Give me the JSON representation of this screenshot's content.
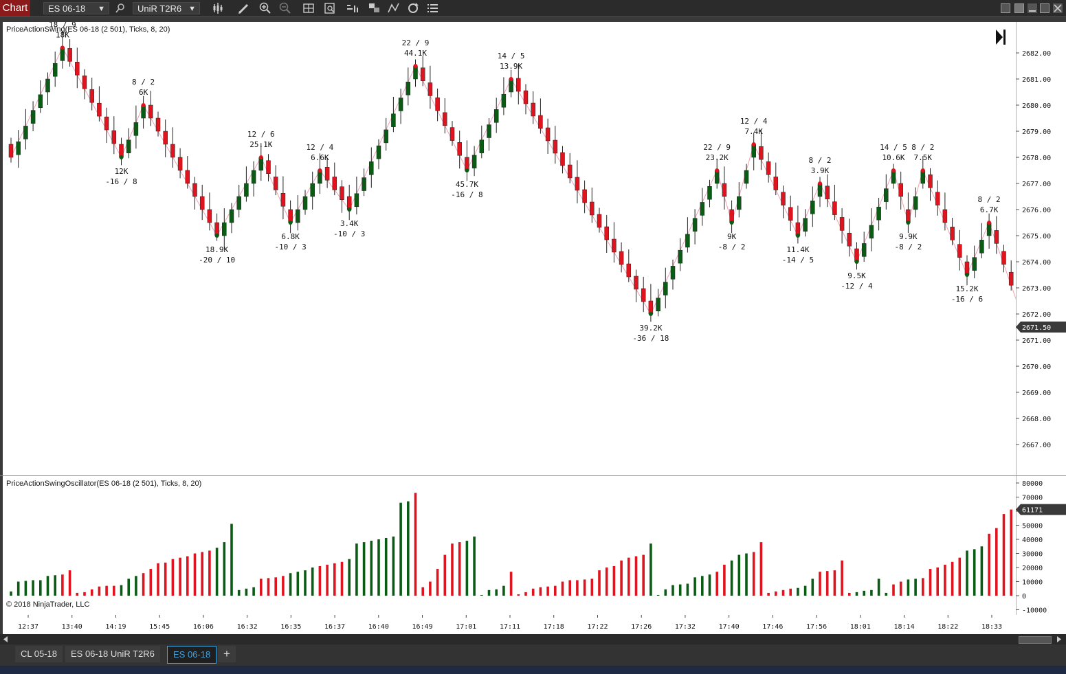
{
  "toolbar": {
    "chart_label": "Chart",
    "instrument": "ES 06-18",
    "bar_type": "UniR T2R6"
  },
  "colors": {
    "up": "#0a5c14",
    "down": "#e0141e",
    "bg": "#ffffff",
    "accent_tab": "#3fa3e0"
  },
  "price_panel": {
    "title": "PriceActionSwing(ES 06-18 (2 501), Ticks, 8, 20)",
    "current_price": "2671.50",
    "y_ticks": [
      "2682.00",
      "2681.00",
      "2680.00",
      "2679.00",
      "2678.00",
      "2677.00",
      "2676.00",
      "2675.00",
      "2674.00",
      "2673.00",
      "2672.00",
      "2671.00",
      "2670.00",
      "2669.00",
      "2668.00",
      "2667.00"
    ],
    "swing_labels": [
      {
        "l1": "18 / 9",
        "l2": "18K"
      },
      {
        "l1": "12K",
        "l2": "-16 / 8"
      },
      {
        "l1": "8 / 2",
        "l2": "6K"
      },
      {
        "l1": "18.9K",
        "l2": "-20 / 10"
      },
      {
        "l1": "12 / 6",
        "l2": "25.1K"
      },
      {
        "l1": "6.8K",
        "l2": "-10 / 3"
      },
      {
        "l1": "12 / 4",
        "l2": "6.6K"
      },
      {
        "l1": "3.4K",
        "l2": "-10 / 3"
      },
      {
        "l1": "22 / 9",
        "l2": "44.1K"
      },
      {
        "l1": "45.7K",
        "l2": "-16 / 8"
      },
      {
        "l1": "14 / 5",
        "l2": "13.9K"
      },
      {
        "l1": "39.2K",
        "l2": "-36 / 18"
      },
      {
        "l1": "22 / 9",
        "l2": "23.2K"
      },
      {
        "l1": "9K",
        "l2": "-8 / 2"
      },
      {
        "l1": "12 / 4",
        "l2": "7.4K"
      },
      {
        "l1": "11.4K",
        "l2": "-14 / 5"
      },
      {
        "l1": "8 / 2",
        "l2": "3.9K"
      },
      {
        "l1": "9.5K",
        "l2": "-12 / 4"
      },
      {
        "l1": "14 / 5",
        "l2": "10.6K"
      },
      {
        "l1": "9.9K",
        "l2": "-8 / 2"
      },
      {
        "l1": "8 / 2",
        "l2": "7.5K"
      },
      {
        "l1": "15.2K",
        "l2": "-16 / 6"
      },
      {
        "l1": "8 / 2",
        "l2": "6.7K"
      }
    ]
  },
  "osc_panel": {
    "title": "PriceActionSwingOscillator(ES 06-18 (2 501), Ticks, 8, 20)",
    "current_value": "61171",
    "y_ticks": [
      "80000",
      "70000",
      "60000",
      "50000",
      "40000",
      "30000",
      "20000",
      "10000",
      "0",
      "-10000"
    ],
    "copyright": "© 2018 NinjaTrader, LLC"
  },
  "time_axis": [
    "12:37",
    "13:40",
    "14:19",
    "15:45",
    "16:06",
    "16:32",
    "16:35",
    "16:37",
    "16:40",
    "16:49",
    "17:01",
    "17:11",
    "17:18",
    "17:22",
    "17:26",
    "17:32",
    "17:40",
    "17:46",
    "17:56",
    "18:01",
    "18:14",
    "18:22",
    "18:33"
  ],
  "tabs": [
    {
      "label": "CL 05-18",
      "active": false
    },
    {
      "label": "ES 06-18 UniR T2R6",
      "active": false
    },
    {
      "label": "ES 06-18",
      "active": true
    }
  ],
  "tab_add_label": "+",
  "chart_data": {
    "type": "candlestick",
    "pivots": [
      {
        "i": 0,
        "p": 2678.0
      },
      {
        "i": 7,
        "p": 2682.2
      },
      {
        "i": 15,
        "p": 2678.0
      },
      {
        "i": 18,
        "p": 2680.0
      },
      {
        "i": 28,
        "p": 2675.0
      },
      {
        "i": 34,
        "p": 2678.0
      },
      {
        "i": 38,
        "p": 2675.5
      },
      {
        "i": 42,
        "p": 2677.5
      },
      {
        "i": 46,
        "p": 2676.0
      },
      {
        "i": 55,
        "p": 2681.5
      },
      {
        "i": 62,
        "p": 2677.5
      },
      {
        "i": 68,
        "p": 2681.0
      },
      {
        "i": 87,
        "p": 2672.0
      },
      {
        "i": 96,
        "p": 2677.5
      },
      {
        "i": 98,
        "p": 2675.5
      },
      {
        "i": 101,
        "p": 2678.5
      },
      {
        "i": 107,
        "p": 2675.0
      },
      {
        "i": 110,
        "p": 2677.0
      },
      {
        "i": 115,
        "p": 2674.0
      },
      {
        "i": 120,
        "p": 2677.5
      },
      {
        "i": 122,
        "p": 2675.5
      },
      {
        "i": 124,
        "p": 2677.5
      },
      {
        "i": 130,
        "p": 2673.5
      },
      {
        "i": 133,
        "p": 2675.5
      },
      {
        "i": 138,
        "p": 2671.5
      }
    ],
    "osc_values": [
      {
        "i": 0,
        "v": 3000
      },
      {
        "i": 1,
        "v": 10000
      },
      {
        "i": 2,
        "v": 10500
      },
      {
        "i": 3,
        "v": 11000
      },
      {
        "i": 4,
        "v": 11000
      },
      {
        "i": 5,
        "v": 14000
      },
      {
        "i": 6,
        "v": 14500
      },
      {
        "i": 7,
        "v": 15000
      },
      {
        "i": 8,
        "v": 18000
      },
      {
        "i": 9,
        "v": 2000
      },
      {
        "i": 10,
        "v": 2500
      },
      {
        "i": 11,
        "v": 4500
      },
      {
        "i": 12,
        "v": 6500
      },
      {
        "i": 13,
        "v": 7000
      },
      {
        "i": 14,
        "v": 7000
      },
      {
        "i": 15,
        "v": 7500
      },
      {
        "i": 16,
        "v": 12000
      },
      {
        "i": 17,
        "v": 14000
      },
      {
        "i": 18,
        "v": 16000
      },
      {
        "i": 19,
        "v": 19000
      },
      {
        "i": 20,
        "v": 23000
      },
      {
        "i": 21,
        "v": 23500
      },
      {
        "i": 22,
        "v": 26000
      },
      {
        "i": 23,
        "v": 27000
      },
      {
        "i": 24,
        "v": 28000
      },
      {
        "i": 25,
        "v": 30000
      },
      {
        "i": 26,
        "v": 31000
      },
      {
        "i": 27,
        "v": 32000
      },
      {
        "i": 28,
        "v": 34000
      },
      {
        "i": 29,
        "v": 38000
      },
      {
        "i": 30,
        "v": 51000
      },
      {
        "i": 31,
        "v": 4000
      },
      {
        "i": 32,
        "v": 5000
      },
      {
        "i": 33,
        "v": 6000
      },
      {
        "i": 34,
        "v": 12000
      },
      {
        "i": 35,
        "v": 12500
      },
      {
        "i": 36,
        "v": 13000
      },
      {
        "i": 37,
        "v": 14000
      },
      {
        "i": 38,
        "v": 16000
      },
      {
        "i": 39,
        "v": 17000
      },
      {
        "i": 40,
        "v": 18000
      },
      {
        "i": 41,
        "v": 20000
      },
      {
        "i": 42,
        "v": 21000
      },
      {
        "i": 43,
        "v": 22000
      },
      {
        "i": 44,
        "v": 23000
      },
      {
        "i": 45,
        "v": 24000
      },
      {
        "i": 46,
        "v": 26000
      },
      {
        "i": 47,
        "v": 37000
      },
      {
        "i": 48,
        "v": 38000
      },
      {
        "i": 49,
        "v": 39000
      },
      {
        "i": 50,
        "v": 40000
      },
      {
        "i": 51,
        "v": 41000
      },
      {
        "i": 52,
        "v": 42000
      },
      {
        "i": 53,
        "v": 66000
      },
      {
        "i": 54,
        "v": 67000
      },
      {
        "i": 55,
        "v": 73000
      },
      {
        "i": 56,
        "v": 6000
      },
      {
        "i": 57,
        "v": 10000
      },
      {
        "i": 58,
        "v": 19000
      },
      {
        "i": 59,
        "v": 29000
      },
      {
        "i": 60,
        "v": 37000
      },
      {
        "i": 61,
        "v": 38000
      },
      {
        "i": 62,
        "v": 39000
      },
      {
        "i": 63,
        "v": 42000
      },
      {
        "i": 64,
        "v": 500
      },
      {
        "i": 65,
        "v": 4000
      },
      {
        "i": 66,
        "v": 4500
      },
      {
        "i": 67,
        "v": 7000
      },
      {
        "i": 68,
        "v": 17000
      },
      {
        "i": 69,
        "v": 1000
      },
      {
        "i": 70,
        "v": 2500
      },
      {
        "i": 71,
        "v": 5000
      },
      {
        "i": 72,
        "v": 6000
      },
      {
        "i": 73,
        "v": 6500
      },
      {
        "i": 74,
        "v": 7000
      },
      {
        "i": 75,
        "v": 10000
      },
      {
        "i": 76,
        "v": 11000
      },
      {
        "i": 77,
        "v": 11000
      },
      {
        "i": 78,
        "v": 11500
      },
      {
        "i": 79,
        "v": 12000
      },
      {
        "i": 80,
        "v": 18000
      },
      {
        "i": 81,
        "v": 20000
      },
      {
        "i": 82,
        "v": 21000
      },
      {
        "i": 83,
        "v": 25000
      },
      {
        "i": 84,
        "v": 27000
      },
      {
        "i": 85,
        "v": 28000
      },
      {
        "i": 86,
        "v": 29000
      },
      {
        "i": 87,
        "v": 37000
      },
      {
        "i": 88,
        "v": 500
      },
      {
        "i": 89,
        "v": 4500
      },
      {
        "i": 90,
        "v": 7500
      },
      {
        "i": 91,
        "v": 8000
      },
      {
        "i": 92,
        "v": 8500
      },
      {
        "i": 93,
        "v": 13000
      },
      {
        "i": 94,
        "v": 14000
      },
      {
        "i": 95,
        "v": 15000
      },
      {
        "i": 96,
        "v": 17000
      },
      {
        "i": 97,
        "v": 22000
      },
      {
        "i": 98,
        "v": 25000
      },
      {
        "i": 99,
        "v": 29000
      },
      {
        "i": 100,
        "v": 30000
      },
      {
        "i": 101,
        "v": 31000
      },
      {
        "i": 102,
        "v": 38000
      },
      {
        "i": 103,
        "v": 2000
      },
      {
        "i": 104,
        "v": 3000
      },
      {
        "i": 105,
        "v": 4000
      },
      {
        "i": 106,
        "v": 5000
      },
      {
        "i": 107,
        "v": 5500
      },
      {
        "i": 108,
        "v": 7000
      },
      {
        "i": 109,
        "v": 12000
      },
      {
        "i": 110,
        "v": 17000
      },
      {
        "i": 111,
        "v": 17500
      },
      {
        "i": 112,
        "v": 18000
      },
      {
        "i": 113,
        "v": 25000
      },
      {
        "i": 114,
        "v": 2000
      },
      {
        "i": 115,
        "v": 2500
      },
      {
        "i": 116,
        "v": 3500
      },
      {
        "i": 117,
        "v": 4000
      },
      {
        "i": 118,
        "v": 12000
      },
      {
        "i": 119,
        "v": 2000
      },
      {
        "i": 120,
        "v": 8000
      },
      {
        "i": 121,
        "v": 10000
      },
      {
        "i": 122,
        "v": 11500
      },
      {
        "i": 123,
        "v": 12000
      },
      {
        "i": 124,
        "v": 12500
      },
      {
        "i": 125,
        "v": 19000
      },
      {
        "i": 126,
        "v": 20000
      },
      {
        "i": 127,
        "v": 22000
      },
      {
        "i": 128,
        "v": 24000
      },
      {
        "i": 129,
        "v": 27000
      },
      {
        "i": 130,
        "v": 32000
      },
      {
        "i": 131,
        "v": 33000
      },
      {
        "i": 132,
        "v": 35000
      },
      {
        "i": 133,
        "v": 44000
      },
      {
        "i": 134,
        "v": 48000
      },
      {
        "i": 135,
        "v": 58000
      },
      {
        "i": 136,
        "v": 61171
      }
    ]
  }
}
